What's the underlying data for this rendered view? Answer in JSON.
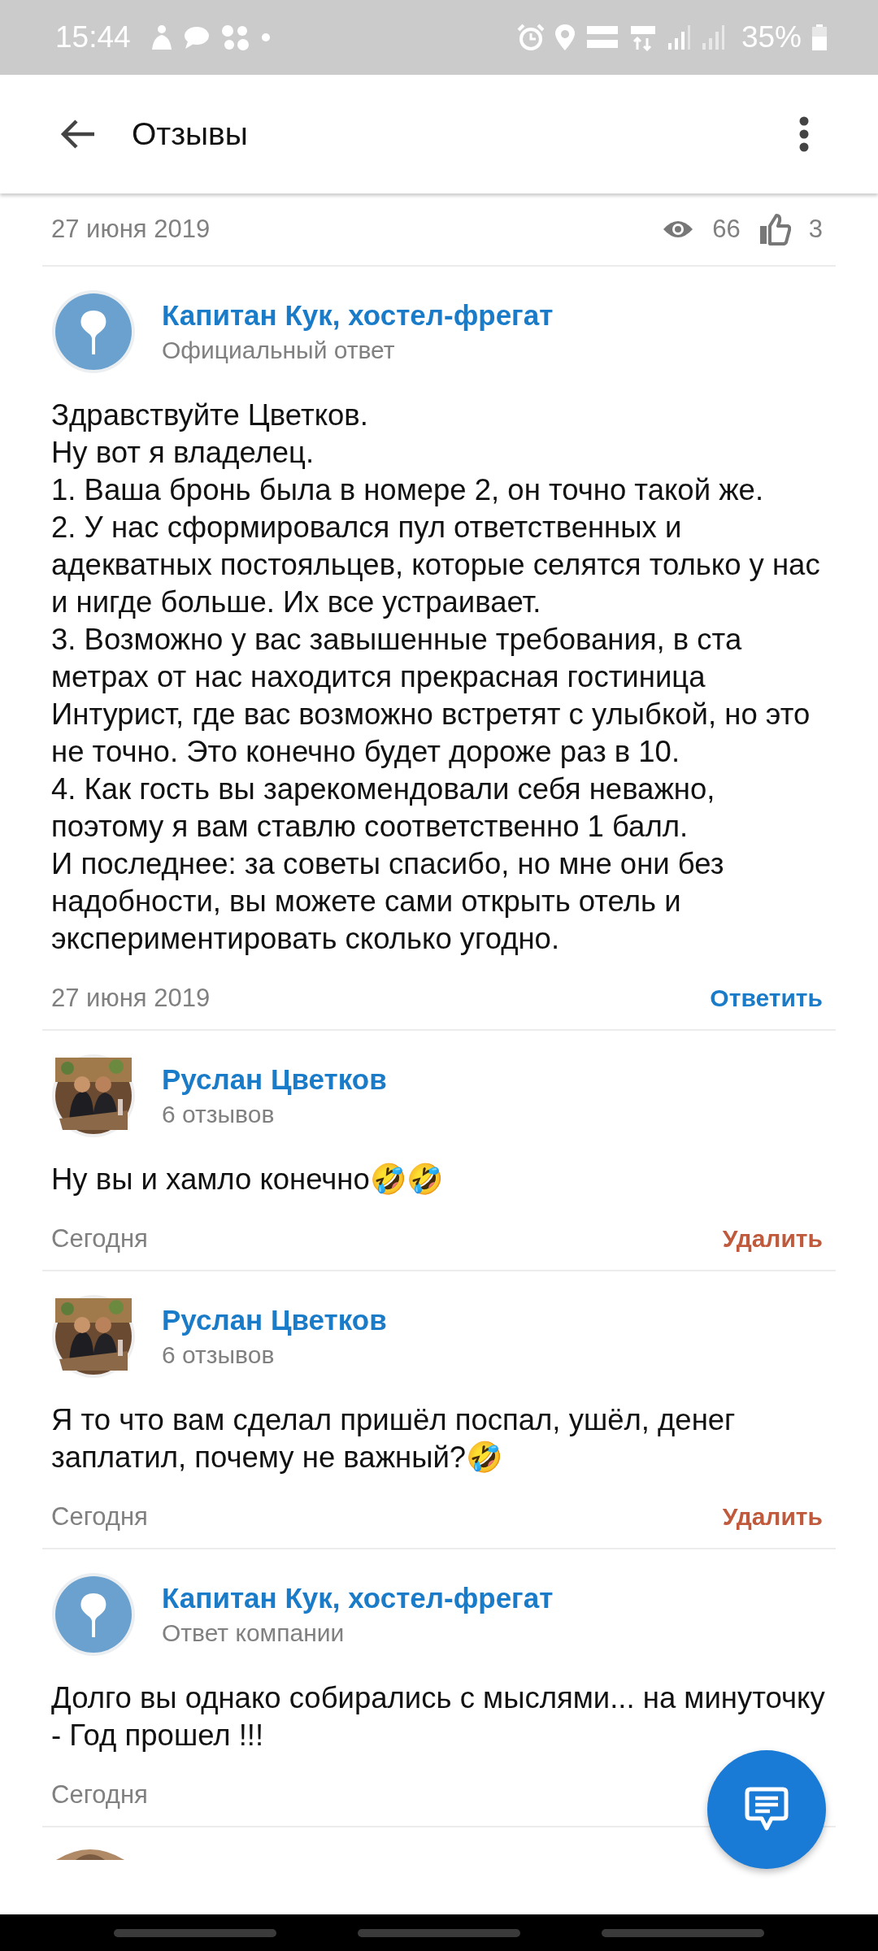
{
  "status_bar": {
    "time": "15:44",
    "battery": "35%"
  },
  "header": {
    "title": "Отзывы"
  },
  "review_meta": {
    "date": "27 июня 2019",
    "views": "66",
    "likes": "3"
  },
  "comments": [
    {
      "avatar": {
        "kind": "logo"
      },
      "author": "Капитан Кук, хостел-фрегат",
      "subtitle": "Официальный ответ",
      "text": "Здравствуйте Цветков.\nНу вот я владелец.\n1. Ваша бронь была в номере 2, он точно такой же.\n2. У нас сформировался пул ответственных и адекватных постояльцев, которые селятся только у нас и нигде больше. Их все устраивает.\n3. Возможно у вас завышенные требования, в ста метрах от нас находится прекрасная гостиница Интурист, где вас возможно встретят с улыбкой, но это не точно. Это конечно будет дороже раз в 10.\n4. Как гость вы зарекомендовали себя неважно, поэтому я вам ставлю соответственно 1 балл.\nИ последнее: за советы спасибо, но мне они без надобности, вы можете сами открыть отель и экспериментировать сколько угодно.",
      "date": "27 июня 2019",
      "action": {
        "kind": "reply",
        "label": "Ответить"
      }
    },
    {
      "author": "Руслан Цветков",
      "subtitle": "6 отзывов",
      "text": "Ну вы и хамло конечно🤣🤣",
      "date": "Сегодня",
      "action": {
        "kind": "delete",
        "label": "Удалить"
      }
    },
    {
      "author": "Руслан Цветков",
      "subtitle": "6 отзывов",
      "text": "Я то что вам сделал пришёл поспал, ушёл, денег заплатил, почему не важный?🤣",
      "date": "Сегодня",
      "action": {
        "kind": "delete",
        "label": "Удалить"
      }
    },
    {
      "avatar": {
        "kind": "logo"
      },
      "author": "Капитан Кук, хостел-фрегат",
      "subtitle": "Ответ компании",
      "text": "Долго вы однако собирались с мыслями... на минуточку - Год прошел !!!",
      "date": "Сегодня"
    }
  ]
}
